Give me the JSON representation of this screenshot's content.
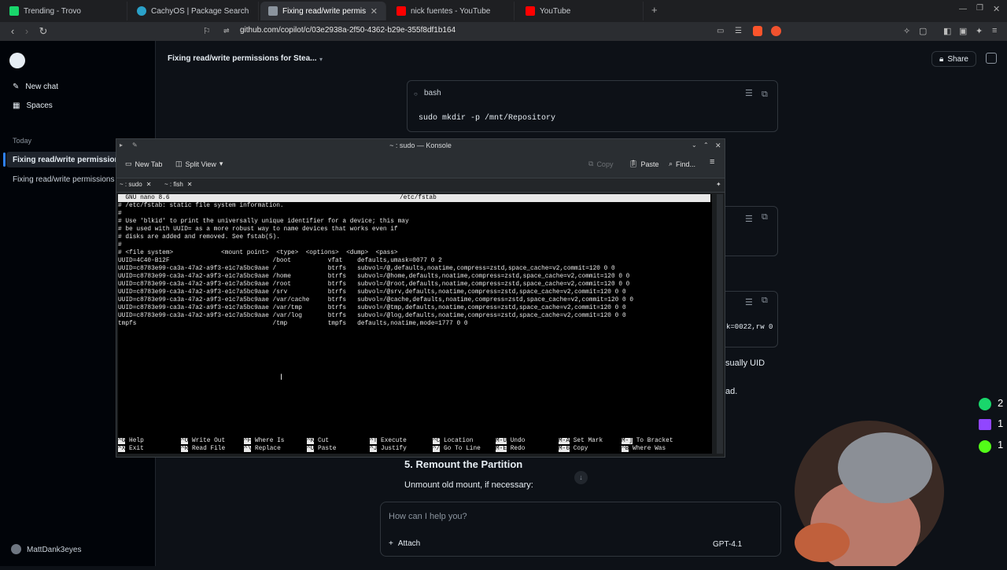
{
  "browser": {
    "tabs": [
      {
        "label": "Trending - Trovo",
        "color": "#19d66b"
      },
      {
        "label": "CachyOS | Package Search",
        "color": "#2aa1c9"
      },
      {
        "label": "Fixing read/write permissions",
        "color": "#8b949e"
      },
      {
        "label": "nick fuentes - YouTube",
        "color": "#ff0000"
      },
      {
        "label": "YouTube",
        "color": "#ff0000"
      }
    ],
    "url": "github.com/copilot/c/03e2938a-2f50-4362-b29e-355f8df1b164"
  },
  "sidebar": {
    "new_chat": "New chat",
    "spaces": "Spaces",
    "today": "Today",
    "items": [
      "Fixing read/write permissions",
      "Fixing read/write permissions"
    ],
    "user": "MattDank3eyes"
  },
  "main": {
    "title": "Fixing read/write permissions for Stea...",
    "share": "Share",
    "code_lang": "bash",
    "code_line": "sudo mkdir -p /mnt/Repository",
    "snippet_right": "k=0022,rw 0",
    "text_right_1": "sually UID",
    "text_right_2": "ad.",
    "section_heading": "5. Remount the Partition",
    "section_text": "Unmount old mount, if necessary:",
    "input_placeholder": "How can I help you?",
    "attach": "Attach",
    "model": "GPT-4.1"
  },
  "konsole": {
    "title": "~ : sudo — Konsole",
    "new_tab": "New Tab",
    "split_view": "Split View",
    "copy": "Copy",
    "paste": "Paste",
    "find": "Find...",
    "tabs": [
      "~ : sudo",
      "~ : fish"
    ]
  },
  "nano": {
    "header_left": "  GNU nano 8.6",
    "header_center": "/etc/fstab",
    "lines": [
      "# /etc/fstab: static file system information.",
      "#",
      "# Use 'blkid' to print the universally unique identifier for a device; this may",
      "# be used with UUID= as a more robust way to name devices that works even if",
      "# disks are added and removed. See fstab(5).",
      "#",
      "# <file system>             <mount point>  <type>  <options>  <dump>  <pass>",
      "UUID=4C40-B12F                            /boot          vfat    defaults,umask=0077 0 2",
      "UUID=c8783e99-ca3a-47a2-a9f3-e1c7a5bc9aae /              btrfs   subvol=/@,defaults,noatime,compress=zstd,space_cache=v2,commit=120 0 0",
      "UUID=c8783e99-ca3a-47a2-a9f3-e1c7a5bc9aae /home          btrfs   subvol=/@home,defaults,noatime,compress=zstd,space_cache=v2,commit=120 0 0",
      "UUID=c8783e99-ca3a-47a2-a9f3-e1c7a5bc9aae /root          btrfs   subvol=/@root,defaults,noatime,compress=zstd,space_cache=v2,commit=120 0 0",
      "UUID=c8783e99-ca3a-47a2-a9f3-e1c7a5bc9aae /srv           btrfs   subvol=/@srv,defaults,noatime,compress=zstd,space_cache=v2,commit=120 0 0",
      "UUID=c8783e99-ca3a-47a2-a9f3-e1c7a5bc9aae /var/cache     btrfs   subvol=/@cache,defaults,noatime,compress=zstd,space_cache=v2,commit=120 0 0",
      "UUID=c8783e99-ca3a-47a2-a9f3-e1c7a5bc9aae /var/tmp       btrfs   subvol=/@tmp,defaults,noatime,compress=zstd,space_cache=v2,commit=120 0 0",
      "UUID=c8783e99-ca3a-47a2-a9f3-e1c7a5bc9aae /var/log       btrfs   subvol=/@log,defaults,noatime,compress=zstd,space_cache=v2,commit=120 0 0",
      "tmpfs                                     /tmp           tmpfs   defaults,noatime,mode=1777 0 0"
    ],
    "shortcuts": [
      {
        "k1": "^G",
        "l1": "Help",
        "k2": "^X",
        "l2": "Exit"
      },
      {
        "k1": "^O",
        "l1": "Write Out",
        "k2": "^R",
        "l2": "Read File"
      },
      {
        "k1": "^F",
        "l1": "Where Is",
        "k2": "^\\",
        "l2": "Replace"
      },
      {
        "k1": "^K",
        "l1": "Cut",
        "k2": "^U",
        "l2": "Paste"
      },
      {
        "k1": "^T",
        "l1": "Execute",
        "k2": "^J",
        "l2": "Justify"
      },
      {
        "k1": "^C",
        "l1": "Location",
        "k2": "^/",
        "l2": "Go To Line"
      },
      {
        "k1": "M-U",
        "l1": "Undo",
        "k2": "M-E",
        "l2": "Redo"
      },
      {
        "k1": "M-A",
        "l1": "Set Mark",
        "k2": "M-6",
        "l2": "Copy"
      },
      {
        "k1": "M-]",
        "l1": "To Bracket",
        "k2": "^B",
        "l2": "Where Was"
      }
    ]
  },
  "stream_overlay": {
    "counts": [
      "2",
      "1",
      "1"
    ]
  }
}
